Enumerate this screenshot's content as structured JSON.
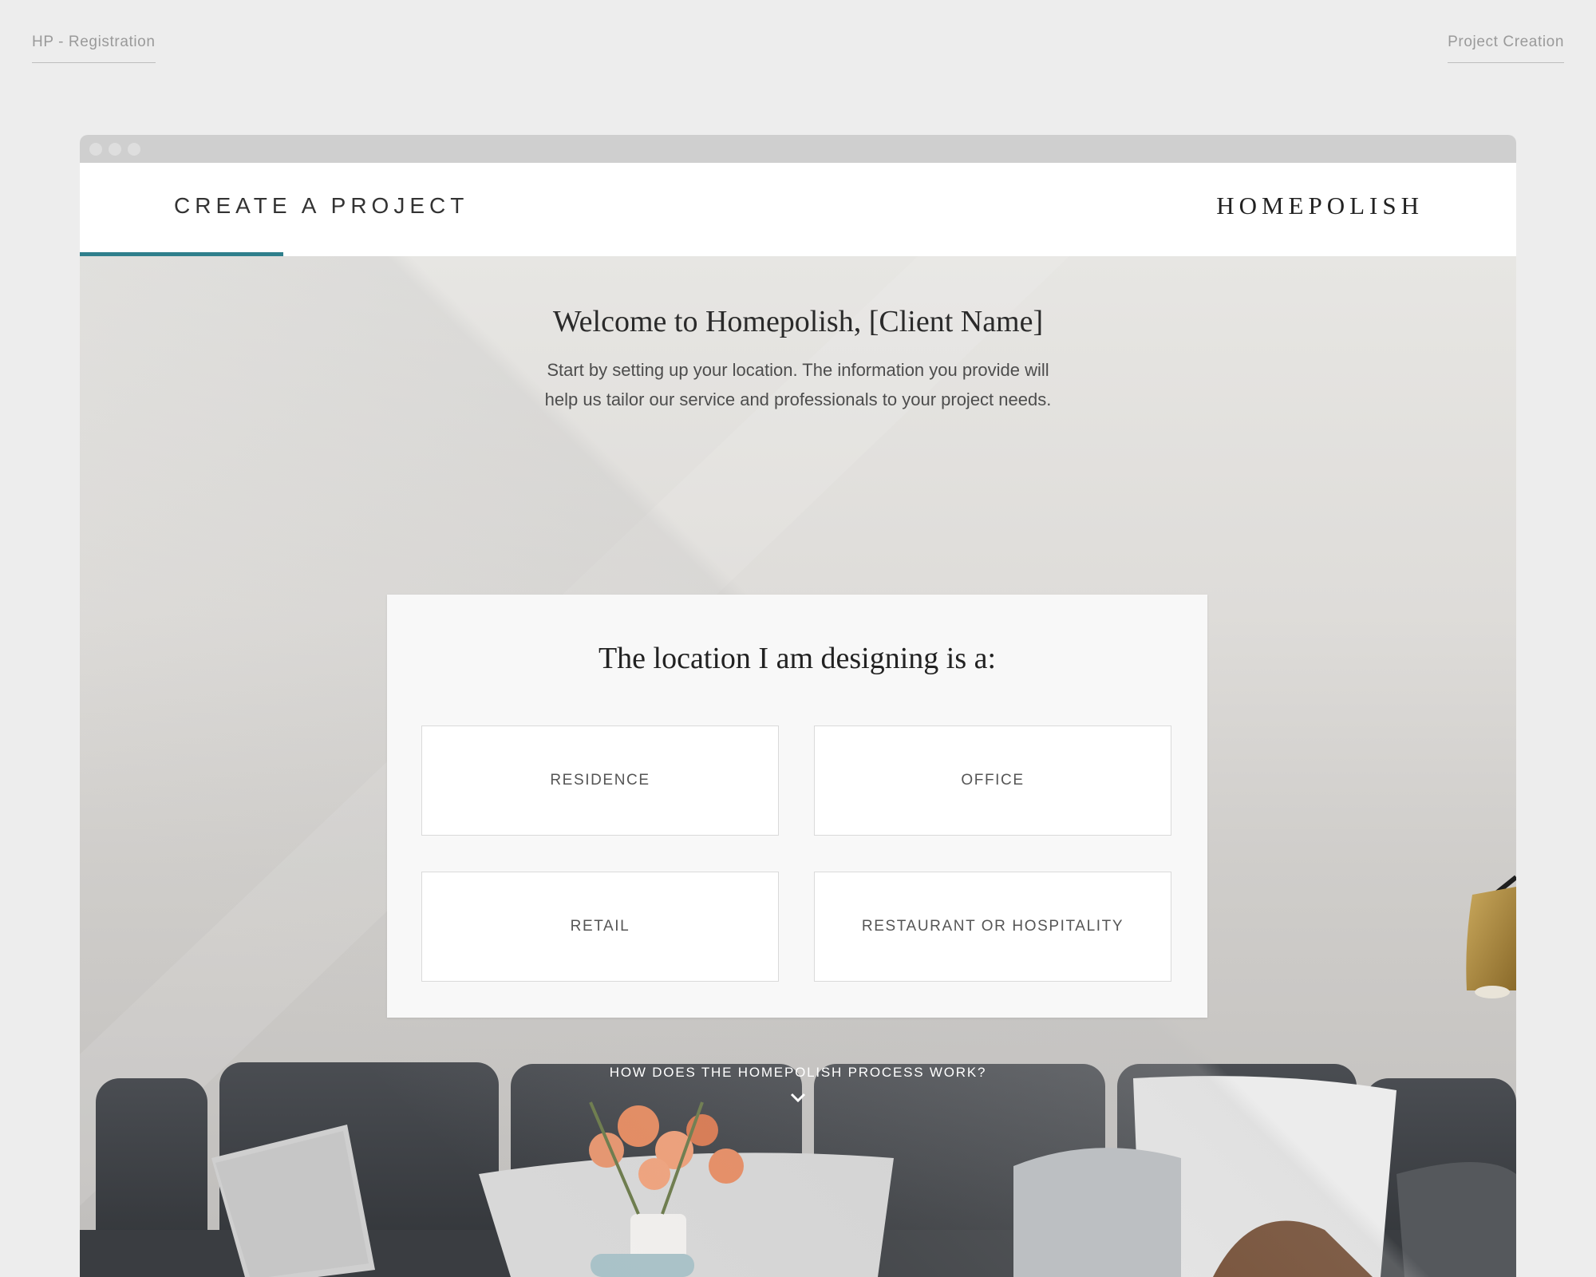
{
  "meta": {
    "left_label": "HP - Registration",
    "right_label": "Project Creation"
  },
  "header": {
    "title": "CREATE A PROJECT",
    "brand": "HOMEPOLISH",
    "accent_color": "#2f7f8c"
  },
  "welcome": {
    "title": "Welcome to Homepolish, [Client Name]",
    "subtitle_line1": "Start by setting up your location. The information you provide will",
    "subtitle_line2": "help us tailor our service and professionals to your project needs."
  },
  "location_card": {
    "title": "The location I am designing is a:",
    "options": [
      {
        "label": "RESIDENCE"
      },
      {
        "label": "OFFICE"
      },
      {
        "label": "RETAIL"
      },
      {
        "label": "RESTAURANT OR HOSPITALITY"
      }
    ]
  },
  "process": {
    "label": "HOW DOES THE HOMEPOLISH PROCESS WORK?",
    "icon": "chevron-down-icon"
  }
}
